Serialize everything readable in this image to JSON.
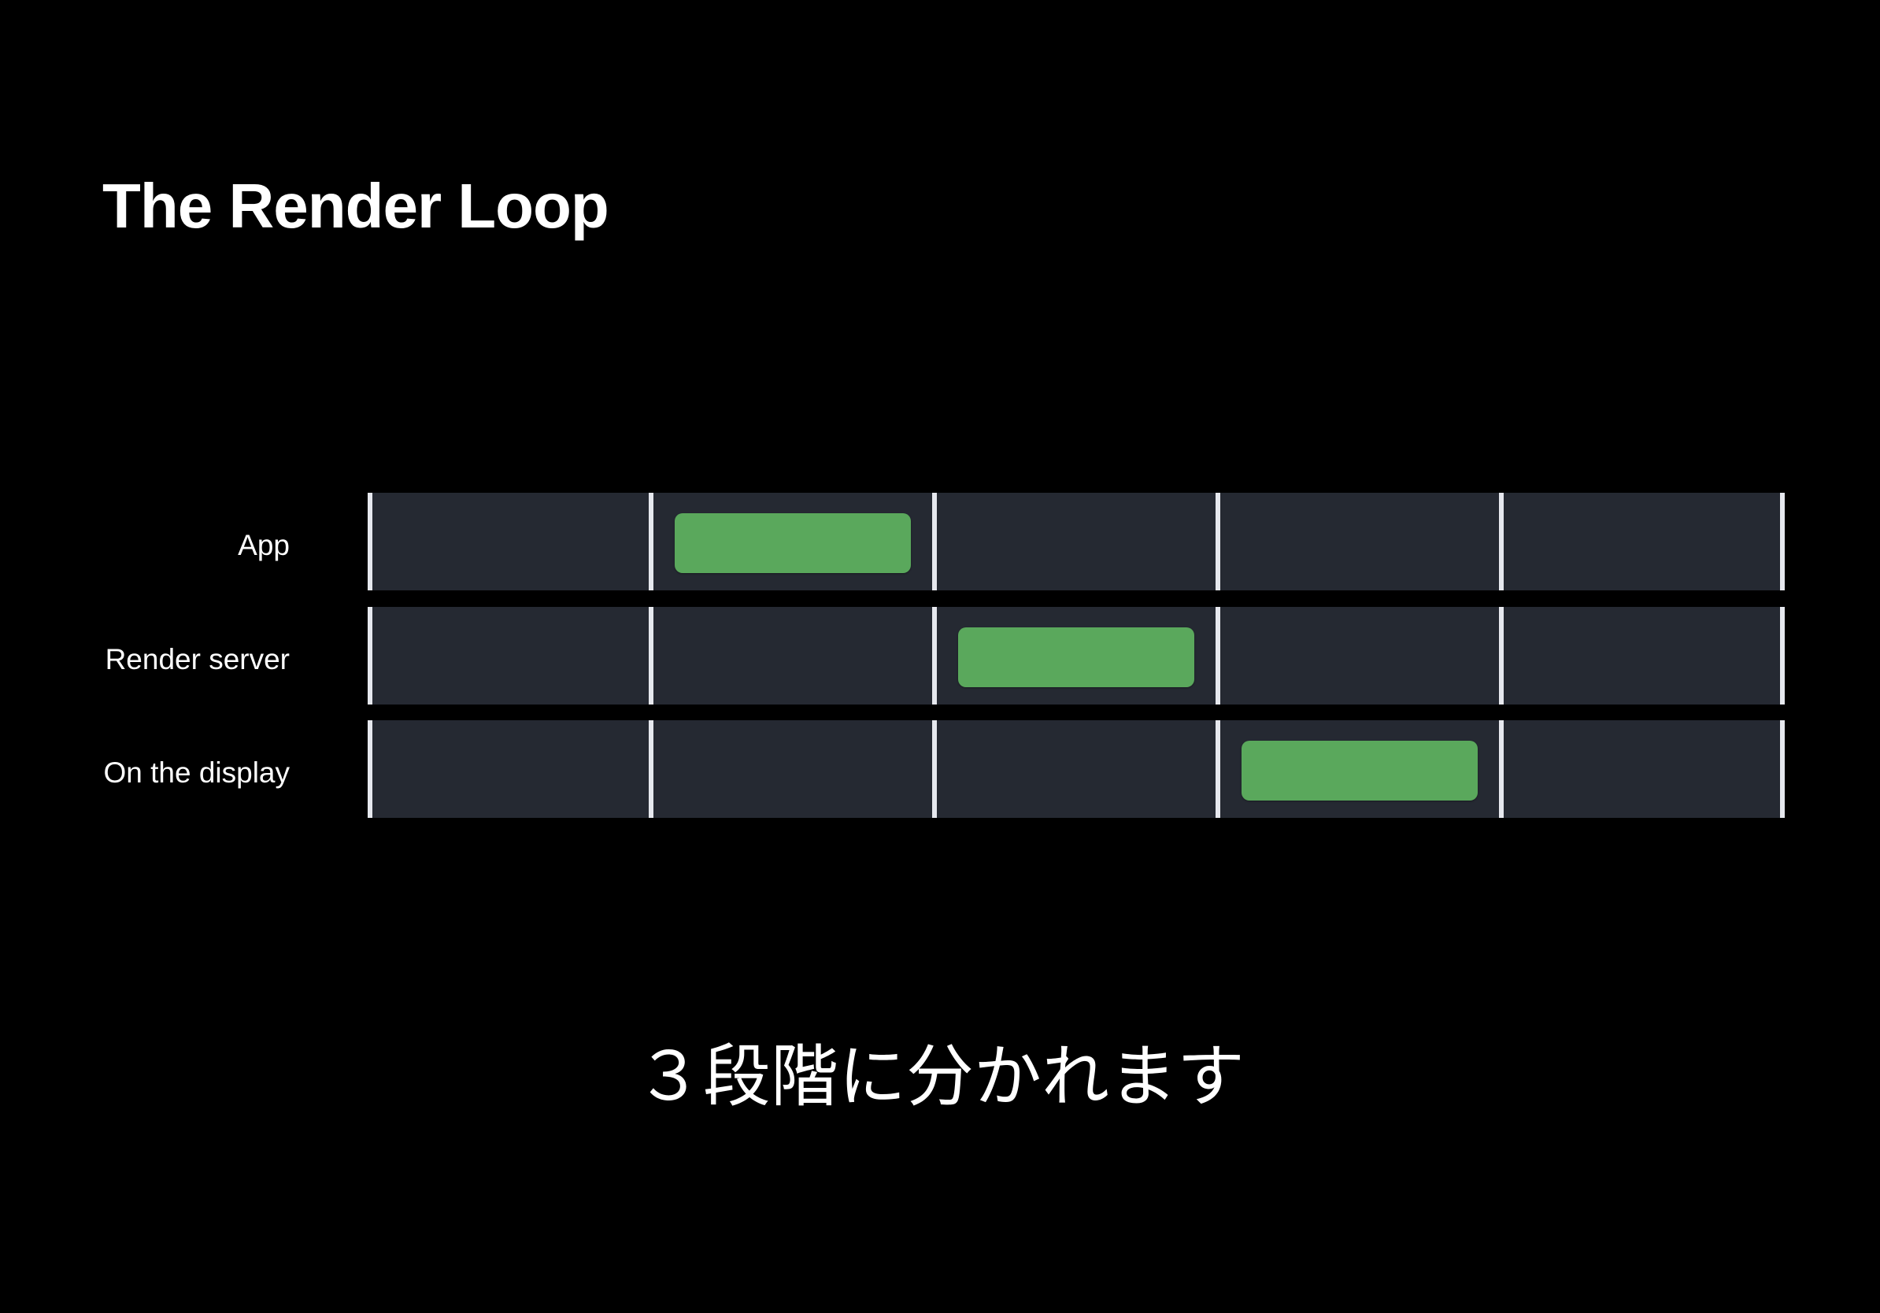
{
  "title": "The Render Loop",
  "subtitle": "３段階に分かれます",
  "colors": {
    "background": "#000000",
    "lane": "#252932",
    "tick": "#e6e8ee",
    "block": "#5aa85c"
  },
  "timeline": {
    "frame_count": 5,
    "rows": [
      {
        "label": "App",
        "active_frame": 2
      },
      {
        "label": "Render server",
        "active_frame": 3
      },
      {
        "label": "On the display",
        "active_frame": 4
      }
    ]
  }
}
